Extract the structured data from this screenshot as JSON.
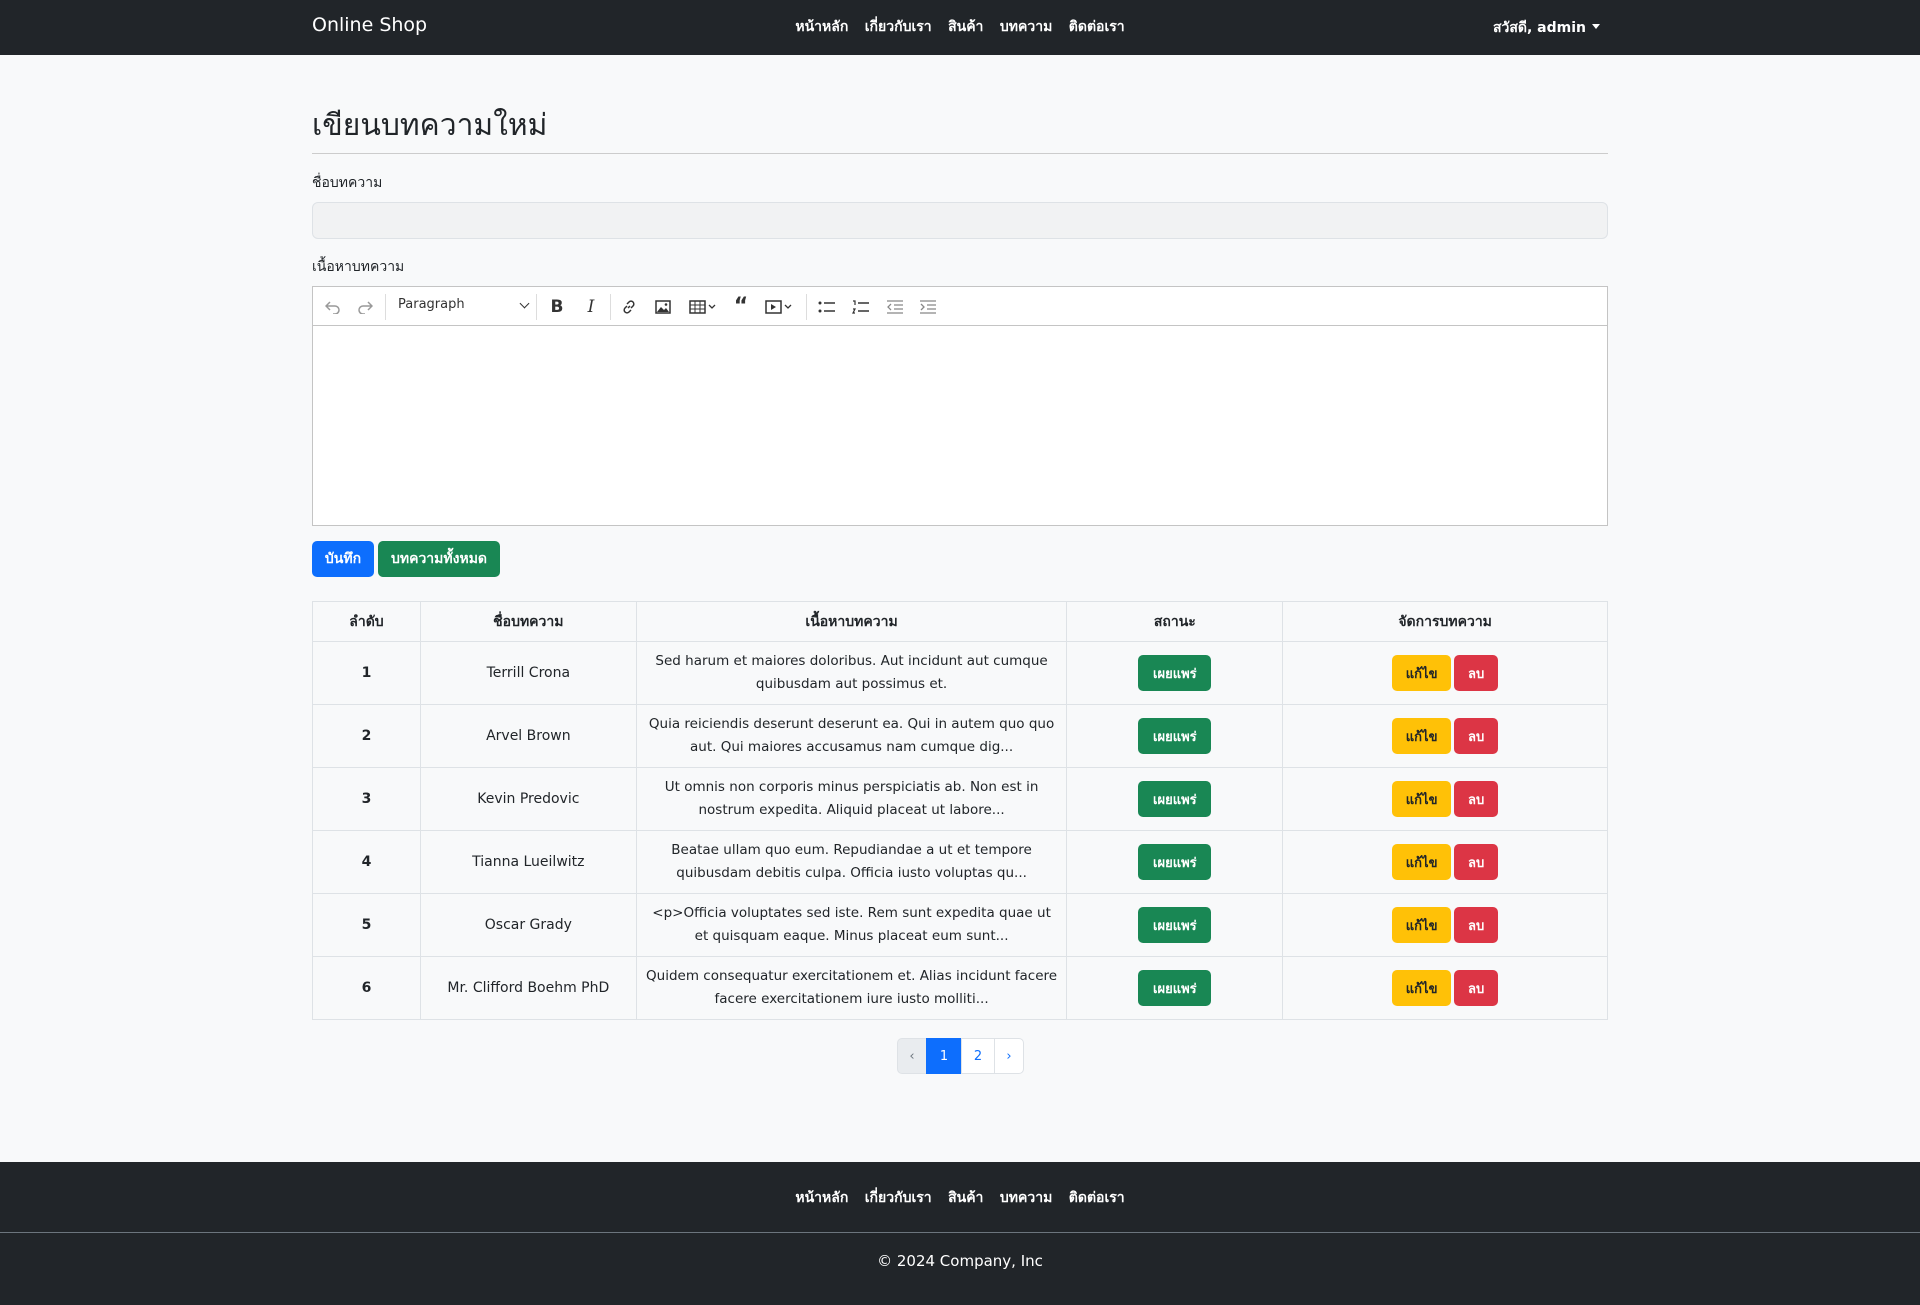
{
  "navbar": {
    "brand": "Online Shop",
    "links": [
      "หน้าหลัก",
      "เกี่ยวกับเรา",
      "สินค้า",
      "บทความ",
      "ติดต่อเรา"
    ],
    "user": "สวัสดี, admin"
  },
  "page_title": "เขียนบทความใหม่",
  "form": {
    "title_label": "ชื่อบทความ",
    "title_value": "",
    "content_label": "เนื้อหาบทความ",
    "editor": {
      "paragraph_select": "Paragraph",
      "icons": [
        "undo-icon",
        "redo-icon",
        "bold-icon",
        "italic-icon",
        "link-icon",
        "image-icon",
        "table-icon",
        "quote-icon",
        "media-icon",
        "bulleted-list-icon",
        "numbered-list-icon",
        "outdent-icon",
        "indent-icon"
      ]
    },
    "save_button": "บันทึก",
    "all_articles_button": "บทความทั้งหมด"
  },
  "table": {
    "headers": [
      "ลำดับ",
      "ชื่อบทความ",
      "เนื้อหาบทความ",
      "สถานะ",
      "จัดการบทความ"
    ],
    "rows": [
      {
        "no": "1",
        "title": "Terrill Crona",
        "content": "Sed harum et maiores doloribus. Aut incidunt aut cumque quibusdam aut possimus et.",
        "status": "เผยแพร่",
        "edit": "แก้ไข",
        "delete": "ลบ"
      },
      {
        "no": "2",
        "title": "Arvel Brown",
        "content": "Quia reiciendis deserunt deserunt ea. Qui in autem quo quo aut. Qui maiores accusamus nam cumque dig...",
        "status": "เผยแพร่",
        "edit": "แก้ไข",
        "delete": "ลบ"
      },
      {
        "no": "3",
        "title": "Kevin Predovic",
        "content": "Ut omnis non corporis minus perspiciatis ab. Non est in nostrum expedita. Aliquid placeat ut labore...",
        "status": "เผยแพร่",
        "edit": "แก้ไข",
        "delete": "ลบ"
      },
      {
        "no": "4",
        "title": "Tianna Lueilwitz",
        "content": "Beatae ullam quo eum. Repudiandae a ut et tempore quibusdam debitis culpa. Officia iusto voluptas qu...",
        "status": "เผยแพร่",
        "edit": "แก้ไข",
        "delete": "ลบ"
      },
      {
        "no": "5",
        "title": "Oscar Grady",
        "content": "<p>Officia voluptates sed iste. Rem sunt expedita quae ut et quisquam eaque. Minus placeat eum sunt...",
        "status": "เผยแพร่",
        "edit": "แก้ไข",
        "delete": "ลบ"
      },
      {
        "no": "6",
        "title": "Mr. Clifford Boehm PhD",
        "content": "Quidem consequatur exercitationem et. Alias incidunt facere facere exercitationem iure iusto molliti...",
        "status": "เผยแพร่",
        "edit": "แก้ไข",
        "delete": "ลบ"
      }
    ]
  },
  "pagination": {
    "prev": "‹",
    "pages": [
      "1",
      "2"
    ],
    "current": "1",
    "next": "›"
  },
  "footer": {
    "links": [
      "หน้าหลัก",
      "เกี่ยวกับเรา",
      "สินค้า",
      "บทความ",
      "ติดต่อเรา"
    ],
    "copyright": "© 2024 Company, Inc"
  },
  "colors": {
    "navbar_bg": "#212529",
    "primary": "#0d6efd",
    "success": "#198754",
    "warning": "#ffc107",
    "danger": "#dc3545"
  }
}
